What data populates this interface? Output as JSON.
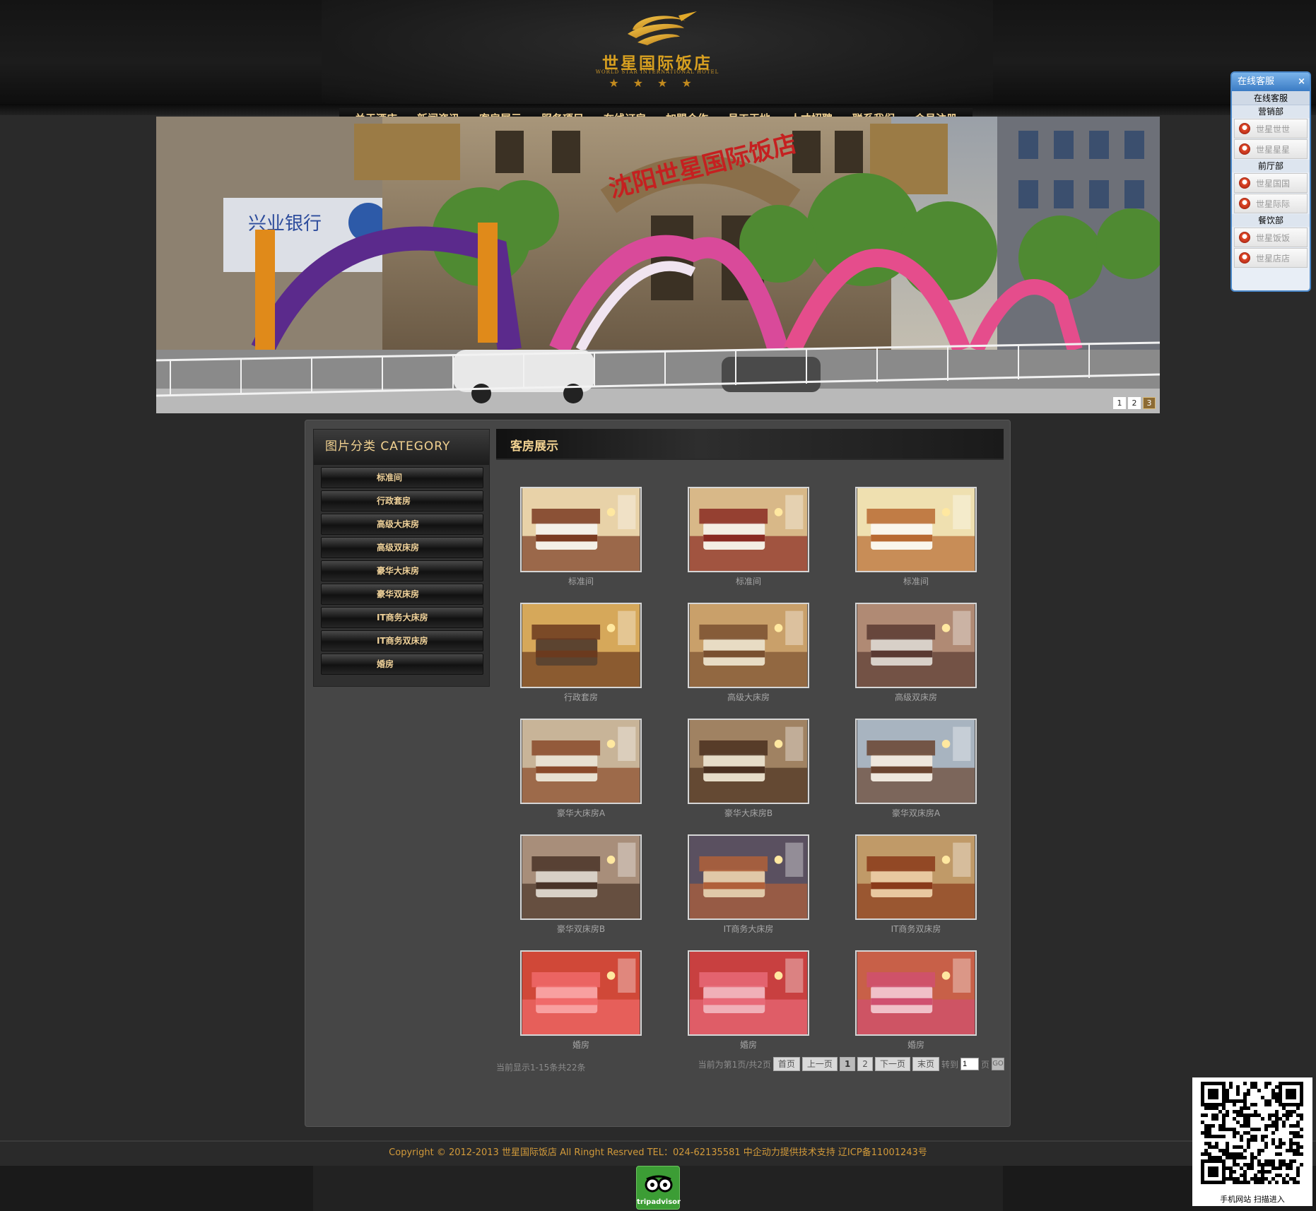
{
  "logo": {
    "name": "世星国际饭店",
    "subtitle": "WORLD STAR INTERNATIONAL HOTEL",
    "stars": "★★★★"
  },
  "nav": [
    "关于酒店",
    "新闻资讯",
    "客房展示",
    "服务项目",
    "在线订房",
    "加盟合作",
    "员工天地",
    "人才招聘",
    "联系我们",
    "会员注册"
  ],
  "banner": {
    "pages": [
      "1",
      "2",
      "3"
    ],
    "active_page": "3"
  },
  "sidebar": {
    "title": "图片分类 CATEGORY",
    "items": [
      "标准间",
      "行政套房",
      "高级大床房",
      "高级双床房",
      "豪华大床房",
      "豪华双床房",
      "IT商务大床房",
      "IT商务双床房",
      "婚房"
    ]
  },
  "content": {
    "title": "客房展示",
    "rooms": [
      {
        "caption": "标准间"
      },
      {
        "caption": "标准间"
      },
      {
        "caption": "标准间"
      },
      {
        "caption": "行政套房"
      },
      {
        "caption": "高级大床房"
      },
      {
        "caption": "高级双床房"
      },
      {
        "caption": "豪华大床房A"
      },
      {
        "caption": "豪华大床房B"
      },
      {
        "caption": "豪华双床房A"
      },
      {
        "caption": "豪华双床房B"
      },
      {
        "caption": "IT商务大床房"
      },
      {
        "caption": "IT商务双床房"
      },
      {
        "caption": "婚房"
      },
      {
        "caption": "婚房"
      },
      {
        "caption": "婚房"
      }
    ]
  },
  "pager": {
    "summary": "当前显示1-15条共22条",
    "position": "当前为第1页/共2页",
    "first": "首页",
    "prev": "上一页",
    "pages": [
      "1",
      "2"
    ],
    "next": "下一页",
    "last": "末页",
    "goto_label": "转到",
    "goto_value": "1",
    "page_suffix": "页",
    "go": "GO"
  },
  "footer": {
    "text": "Copyright © 2012-2013 世星国际饭店 All Ringht Resrved   TEL：024-62135581   中企动力提供技术支持  辽ICP备11001243号"
  },
  "tripadvisor": {
    "label": "tripadvisor"
  },
  "service_panel": {
    "title": "在线客服",
    "close": "×",
    "subtitle": "在线客服",
    "departments": [
      {
        "name": "营销部",
        "staff": [
          "世星世世",
          "世星星星"
        ]
      },
      {
        "name": "前厅部",
        "staff": [
          "世星国国",
          "世星际际"
        ]
      },
      {
        "name": "餐饮部",
        "staff": [
          "世星饭饭",
          "世星店店"
        ]
      }
    ]
  },
  "qr": {
    "caption": "手机网站  扫描进入"
  },
  "colors": {
    "accent_gold": "#f2d291",
    "background": "#2a2a2a",
    "panel": "#464646",
    "footer_text": "#d29a3a",
    "service_blue": "#4a87c8"
  }
}
